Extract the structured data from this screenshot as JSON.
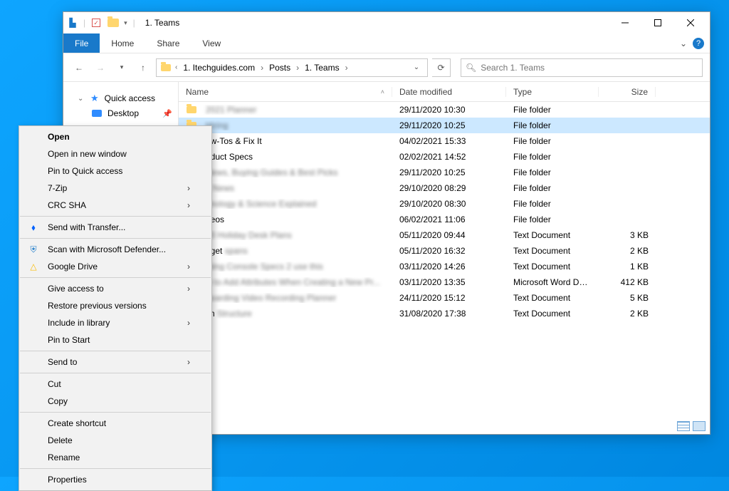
{
  "titlebar": {
    "title": "1. Teams"
  },
  "ribbon": {
    "file": "File",
    "home": "Home",
    "share": "Share",
    "view": "View"
  },
  "breadcrumbs": [
    "1. Itechguides.com",
    "Posts",
    "1. Teams"
  ],
  "search": {
    "placeholder": "Search 1. Teams"
  },
  "navpane": {
    "quick_access": "Quick access",
    "desktop": "Desktop"
  },
  "columns": {
    "name": "Name",
    "date": "Date modified",
    "type": "Type",
    "size": "Size"
  },
  "rows": [
    {
      "name": "2021 Planner",
      "date": "29/11/2020 10:30",
      "type": "File folder",
      "size": "",
      "kind": "folder",
      "blur_name": true
    },
    {
      "name": "Hiring",
      "date": "29/11/2020 10:25",
      "type": "File folder",
      "size": "",
      "kind": "folder",
      "blur_name": true,
      "selected": true
    },
    {
      "name": "ow-Tos & Fix It",
      "date": "04/02/2021 15:33",
      "type": "File folder",
      "size": "",
      "kind": "folder"
    },
    {
      "name": "oduct Specs",
      "date": "02/02/2021 14:52",
      "type": "File folder",
      "size": "",
      "kind": "folder"
    },
    {
      "name": "views, Buying Guides & Best Picks",
      "date": "29/11/2020 10:25",
      "type": "File folder",
      "size": "",
      "kind": "folder",
      "blur_name": true
    },
    {
      "name": "h News",
      "date": "29/10/2020 08:29",
      "type": "File folder",
      "size": "",
      "kind": "folder",
      "blur_tail": true
    },
    {
      "name": "hnology & Science Explained",
      "date": "29/10/2020 08:30",
      "type": "File folder",
      "size": "",
      "kind": "folder",
      "blur_name": true
    },
    {
      "name": "deos",
      "date": "06/02/2021 11:06",
      "type": "File folder",
      "size": "",
      "kind": "folder"
    },
    {
      "name": "20 Holiday Desk Plans",
      "date": "05/11/2020 09:44",
      "type": "Text Document",
      "size": "3 KB",
      "kind": "txt",
      "blur_name": true
    },
    {
      "name": "dget spans",
      "date": "05/11/2020 16:32",
      "type": "Text Document",
      "size": "2 KB",
      "kind": "txt",
      "blur_tail": true
    },
    {
      "name": "ming Console Specs 2 use this",
      "date": "03/11/2020 14:26",
      "type": "Text Document",
      "size": "1 KB",
      "kind": "txt",
      "blur_name": true
    },
    {
      "name": "w to Add Attributes When Creating a New Pr...",
      "date": "03/11/2020 13:35",
      "type": "Microsoft Word Doc...",
      "size": "412 KB",
      "kind": "doc",
      "blur_name": true
    },
    {
      "name": "boarding Video Recording Planner",
      "date": "24/11/2020 15:12",
      "type": "Text Document",
      "size": "5 KB",
      "kind": "txt",
      "blur_name": true
    },
    {
      "name": "im Structure",
      "date": "31/08/2020 17:38",
      "type": "Text Document",
      "size": "2 KB",
      "kind": "txt",
      "blur_tail": true
    }
  ],
  "context_menu": {
    "open": "Open",
    "open_new": "Open in new window",
    "pin_qa": "Pin to Quick access",
    "seven_zip": "7-Zip",
    "crc": "CRC SHA",
    "send_transfer": "Send with Transfer...",
    "defender": "Scan with Microsoft Defender...",
    "gdrive": "Google Drive",
    "give_access": "Give access to",
    "restore": "Restore previous versions",
    "include_lib": "Include in library",
    "pin_start": "Pin to Start",
    "send_to": "Send to",
    "cut": "Cut",
    "copy": "Copy",
    "create_shortcut": "Create shortcut",
    "delete": "Delete",
    "rename": "Rename",
    "properties": "Properties"
  }
}
